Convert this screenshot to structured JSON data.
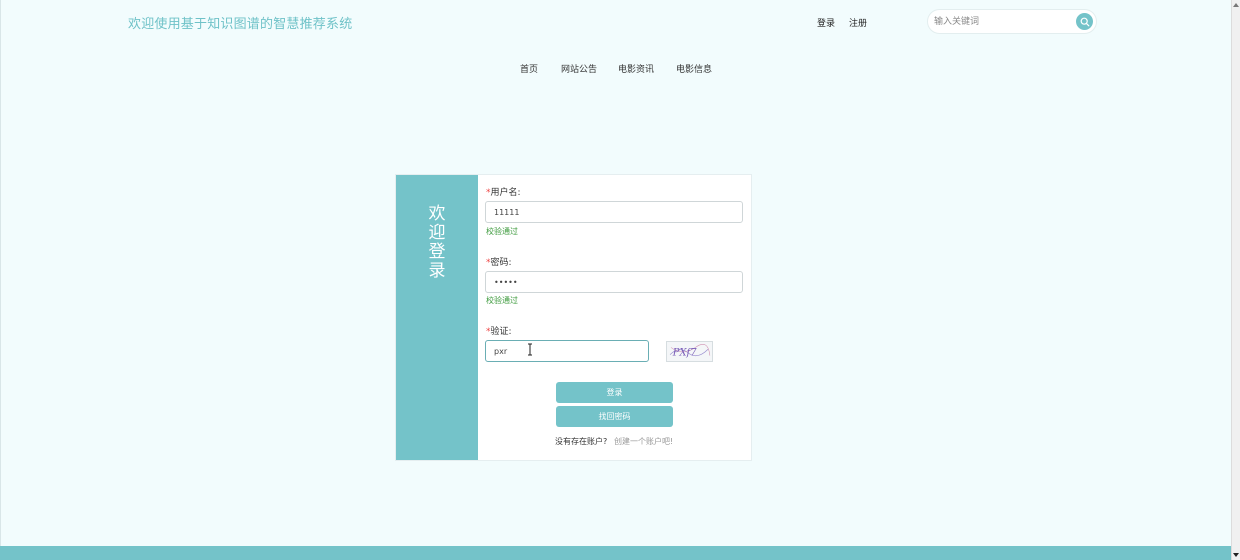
{
  "header": {
    "site_title": "欢迎使用基于知识图谱的智慧推荐系统",
    "login_link": "登录",
    "register_link": "注册",
    "search_placeholder": "输入关键词"
  },
  "nav": {
    "items": [
      "首页",
      "网站公告",
      "电影资讯",
      "电影信息"
    ]
  },
  "login_form": {
    "side_title": "欢迎登录",
    "username": {
      "required_mark": "*",
      "label": "用户名:",
      "value": "11111",
      "validation": "校验通过"
    },
    "password": {
      "required_mark": "*",
      "label": "密码:",
      "value": "•••••",
      "validation": "校验通过"
    },
    "captcha": {
      "required_mark": "*",
      "label": "验证:",
      "value": "pxr",
      "image_text": "PXf7"
    },
    "login_button": "登录",
    "forgot_button": "找回密码",
    "no_account_text": "没有存在账户?",
    "create_account_link": "创建一个账户吧!"
  },
  "colors": {
    "accent": "#74c3c9",
    "background": "#f2fcfd",
    "valid": "#3c9a3c",
    "required": "#ee4444"
  }
}
